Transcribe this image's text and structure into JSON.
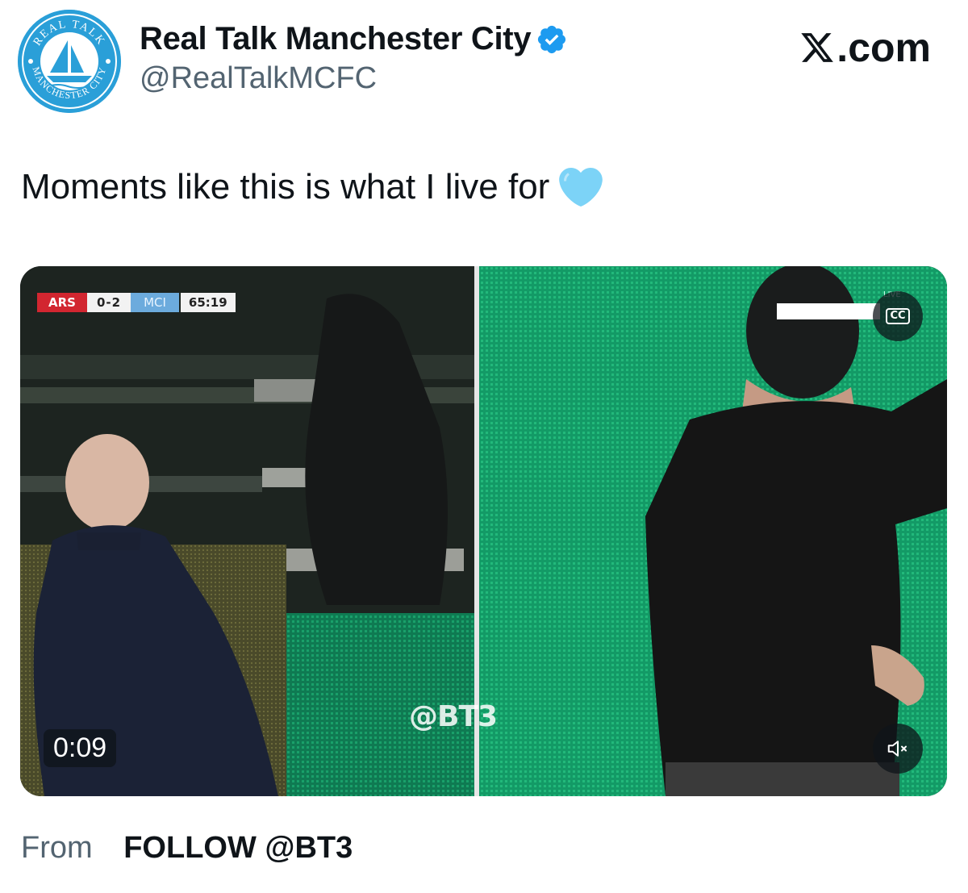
{
  "header": {
    "avatar_text_top": "REAL TALK",
    "avatar_text_bottom": "MANCHESTER CITY",
    "display_name": "Real Talk Manchester City",
    "verified_icon": "verified-badge-icon",
    "handle": "@RealTalkMCFC",
    "site_label": ".com",
    "site_icon": "x-logo-icon"
  },
  "tweet": {
    "text": "Moments like this is what I live for",
    "emoji": "light-blue-heart-icon"
  },
  "media": {
    "scoreboard": {
      "home": "ARS",
      "score": "0-2",
      "away": "MCI",
      "clock": "65:19"
    },
    "live_label": "LIVE",
    "cc_label": "CC",
    "watermark": "@BT3",
    "timer": "0:09",
    "mute_icon": "speaker-muted-icon"
  },
  "attribution": {
    "from_label": "From",
    "source": "FOLLOW @BT3"
  },
  "colors": {
    "brand_blue": "#2a9fd8",
    "verified_blue": "#1d9bf0",
    "secondary_text": "#536471",
    "pitch_green": "#15a06a",
    "arsenal_red": "#d22630",
    "city_blue": "#6cabdd"
  }
}
